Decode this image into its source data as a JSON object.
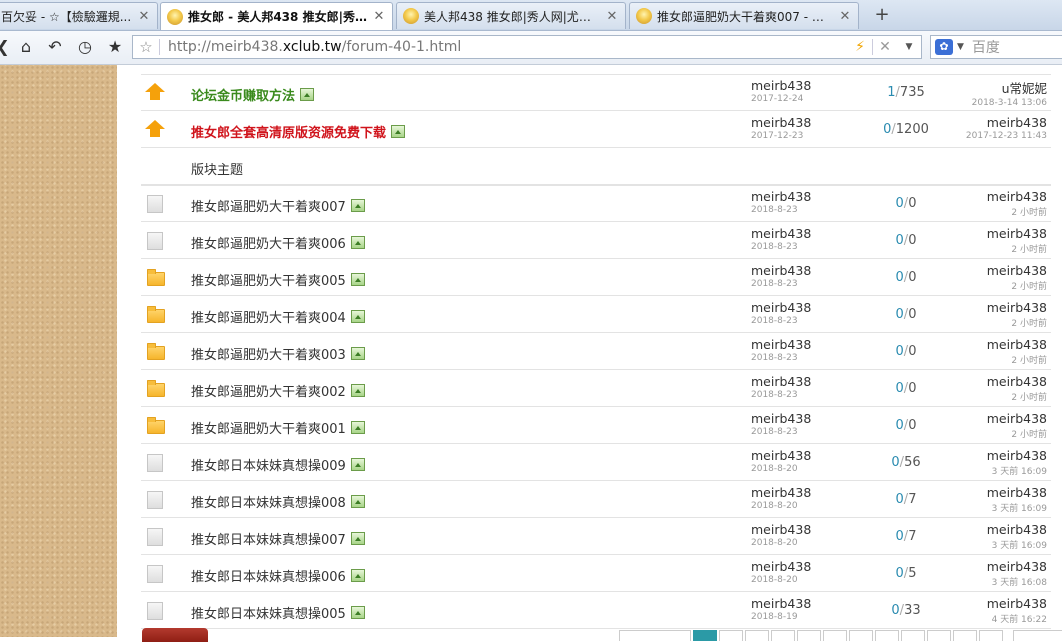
{
  "tabs": [
    {
      "title": "百欠妥 - ☆【檢驗邏規...",
      "active": false,
      "favicon": false
    },
    {
      "title": "推女郎 - 美人邦438 推女郎|秀...",
      "active": true,
      "favicon": true
    },
    {
      "title": "美人邦438 推女郎|秀人网|尤果网...",
      "active": false,
      "favicon": true
    },
    {
      "title": "推女郎逼肥奶大干着爽007 - 推...",
      "active": false,
      "favicon": true
    }
  ],
  "newtab_label": "+",
  "close_glyph": "✕",
  "url": {
    "prefix": "http://meirb438.",
    "host": "xclub.tw",
    "path": "/forum-40-1.html"
  },
  "search_placeholder": "百度",
  "sticky": [
    {
      "title": "论坛金币赚取方法",
      "style": "green",
      "author": "meirb438",
      "date": "2017-12-24",
      "replies": "1",
      "views": "735",
      "last_user": "u常妮妮",
      "last_time": "2018-3-14 13:06"
    },
    {
      "title": "推女郎全套高清原版资源免费下载",
      "style": "red",
      "author": "meirb438",
      "date": "2017-12-23",
      "replies": "0",
      "views": "1200",
      "last_user": "meirb438",
      "last_time": "2017-12-23 11:43"
    }
  ],
  "section_label": "版块主题",
  "threads": [
    {
      "title": "推女郎逼肥奶大干着爽007",
      "icon": "doc",
      "author": "meirb438",
      "date": "2018-8-23",
      "replies": "0",
      "views": "0",
      "last_user": "meirb438",
      "last_time": "2 小时前"
    },
    {
      "title": "推女郎逼肥奶大干着爽006",
      "icon": "doc",
      "author": "meirb438",
      "date": "2018-8-23",
      "replies": "0",
      "views": "0",
      "last_user": "meirb438",
      "last_time": "2 小时前"
    },
    {
      "title": "推女郎逼肥奶大干着爽005",
      "icon": "folder",
      "author": "meirb438",
      "date": "2018-8-23",
      "replies": "0",
      "views": "0",
      "last_user": "meirb438",
      "last_time": "2 小时前"
    },
    {
      "title": "推女郎逼肥奶大干着爽004",
      "icon": "folder",
      "author": "meirb438",
      "date": "2018-8-23",
      "replies": "0",
      "views": "0",
      "last_user": "meirb438",
      "last_time": "2 小时前"
    },
    {
      "title": "推女郎逼肥奶大干着爽003",
      "icon": "folder",
      "author": "meirb438",
      "date": "2018-8-23",
      "replies": "0",
      "views": "0",
      "last_user": "meirb438",
      "last_time": "2 小时前"
    },
    {
      "title": "推女郎逼肥奶大干着爽002",
      "icon": "folder",
      "author": "meirb438",
      "date": "2018-8-23",
      "replies": "0",
      "views": "0",
      "last_user": "meirb438",
      "last_time": "2 小时前"
    },
    {
      "title": "推女郎逼肥奶大干着爽001",
      "icon": "folder",
      "author": "meirb438",
      "date": "2018-8-23",
      "replies": "0",
      "views": "0",
      "last_user": "meirb438",
      "last_time": "2 小时前"
    },
    {
      "title": "推女郎日本妹妹真想操009",
      "icon": "doc",
      "author": "meirb438",
      "date": "2018-8-20",
      "replies": "0",
      "views": "56",
      "last_user": "meirb438",
      "last_time": "3 天前 16:09"
    },
    {
      "title": "推女郎日本妹妹真想操008",
      "icon": "doc",
      "author": "meirb438",
      "date": "2018-8-20",
      "replies": "0",
      "views": "7",
      "last_user": "meirb438",
      "last_time": "3 天前 16:09"
    },
    {
      "title": "推女郎日本妹妹真想操007",
      "icon": "doc",
      "author": "meirb438",
      "date": "2018-8-20",
      "replies": "0",
      "views": "7",
      "last_user": "meirb438",
      "last_time": "3 天前 16:09"
    },
    {
      "title": "推女郎日本妹妹真想操006",
      "icon": "doc",
      "author": "meirb438",
      "date": "2018-8-20",
      "replies": "0",
      "views": "5",
      "last_user": "meirb438",
      "last_time": "3 天前 16:08"
    },
    {
      "title": "推女郎日本妹妹真想操005",
      "icon": "doc",
      "author": "meirb438",
      "date": "2018-8-19",
      "replies": "0",
      "views": "33",
      "last_user": "meirb438",
      "last_time": "4 天前 16:22"
    }
  ],
  "colors": {
    "sticky_green": "#3a8a1d",
    "sticky_red": "#d0141c",
    "reply_count": "#2a8bb0",
    "pager_current": "#2b9aa6"
  }
}
